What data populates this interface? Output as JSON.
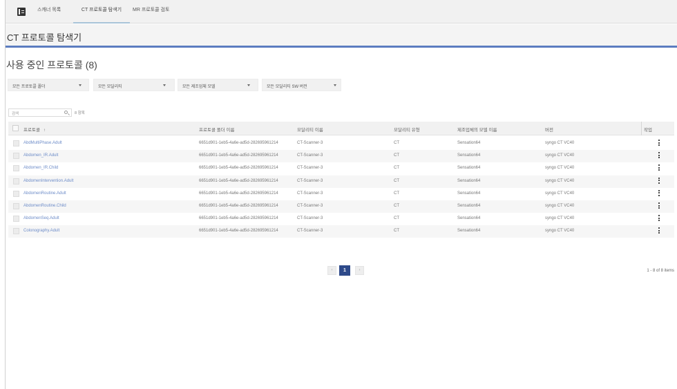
{
  "nav": {
    "tabs": [
      {
        "label": "스캐너 목록"
      },
      {
        "label": "CT 프로토콜 탐색기"
      },
      {
        "label": "MR 프로토콜 검토"
      }
    ]
  },
  "page_title": "CT 프로토콜 탐색기",
  "section_title": "사용 중인 프로토콜 (8)",
  "filters": [
    {
      "label": "모든 프로토콜 폴더"
    },
    {
      "label": "모든 모달리티"
    },
    {
      "label": "모든 제조업체 모델"
    },
    {
      "label": "모든 모달리티 SW 버전"
    }
  ],
  "search": {
    "placeholder": "검색",
    "count_text": "8 항목"
  },
  "table": {
    "columns": [
      "프로토콜",
      "프로토콜 폴더 이름",
      "모달리티 이름",
      "모달리티 유형",
      "제조업체의 모델 이름",
      "버전",
      "작업"
    ],
    "sort_indicator": "↑",
    "rows": [
      {
        "name": "AbdMultiPhase.Adult",
        "folder": "6651d901-1eb5-4a6e-ad5d-282695961214",
        "modality_name": "CT-Scanner-3",
        "modality_type": "CT",
        "model": "Sensation64",
        "version": "syngo CT VC40"
      },
      {
        "name": "Abdomen_IR.Adult",
        "folder": "6651d901-1eb5-4a6e-ad5d-282695961214",
        "modality_name": "CT-Scanner-3",
        "modality_type": "CT",
        "model": "Sensation64",
        "version": "syngo CT VC40"
      },
      {
        "name": "Abdomen_IR.Child",
        "folder": "6651d901-1eb5-4a6e-ad5d-282695961214",
        "modality_name": "CT-Scanner-3",
        "modality_type": "CT",
        "model": "Sensation64",
        "version": "syngo CT VC40"
      },
      {
        "name": "AbdomenIntervention.Adult",
        "folder": "6651d901-1eb5-4a6e-ad5d-282695961214",
        "modality_name": "CT-Scanner-3",
        "modality_type": "CT",
        "model": "Sensation64",
        "version": "syngo CT VC40"
      },
      {
        "name": "AbdomenRoutine.Adult",
        "folder": "6651d901-1eb5-4a6e-ad5d-282695961214",
        "modality_name": "CT-Scanner-3",
        "modality_type": "CT",
        "model": "Sensation64",
        "version": "syngo CT VC40"
      },
      {
        "name": "AbdomenRoutine.Child",
        "folder": "6651d901-1eb5-4a6e-ad5d-282695961214",
        "modality_name": "CT-Scanner-3",
        "modality_type": "CT",
        "model": "Sensation64",
        "version": "syngo CT VC40"
      },
      {
        "name": "AbdomenSeq.Adult",
        "folder": "6651d901-1eb5-4a6e-ad5d-282695961214",
        "modality_name": "CT-Scanner-3",
        "modality_type": "CT",
        "model": "Sensation64",
        "version": "syngo CT VC40"
      },
      {
        "name": "Colonography.Adult",
        "folder": "6651d901-1eb5-4a6e-ad5d-282695961214",
        "modality_name": "CT-Scanner-3",
        "modality_type": "CT",
        "model": "Sensation64",
        "version": "syngo CT VC40"
      }
    ]
  },
  "pagination": {
    "prev": "‹",
    "current": "1",
    "next": "›",
    "info": "1 - 8 of 8 items"
  },
  "colors": {
    "accent_bar": "#5b7cc0",
    "active_page": "#2e4a8a",
    "link": "#6d8cc8"
  },
  "icons": {
    "menu": "menu-icon",
    "search": "search-icon",
    "row_action": "kebab-menu-icon"
  }
}
